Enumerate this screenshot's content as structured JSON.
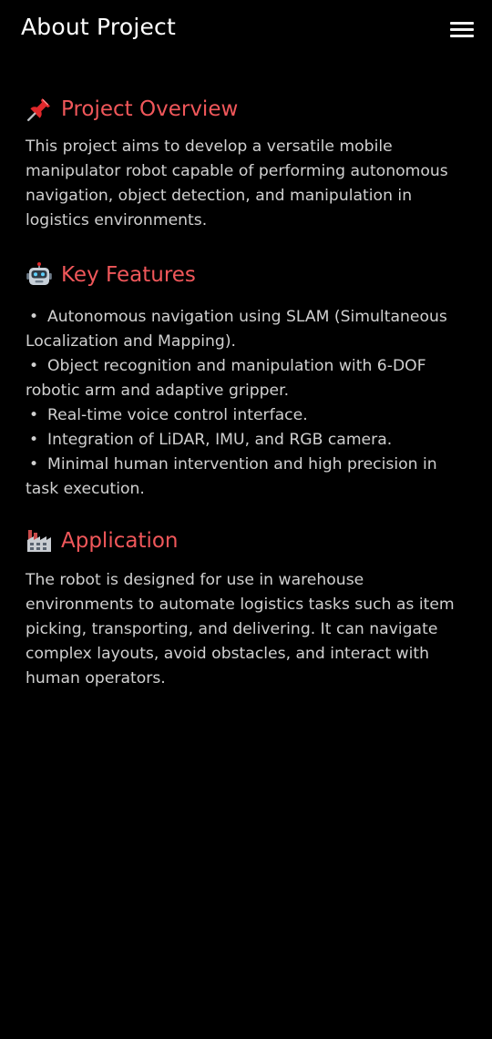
{
  "header": {
    "title": "About Project",
    "menu_icon": "hamburger-menu-icon"
  },
  "colors": {
    "background": "#000000",
    "heading": "#f0575a",
    "body_text": "#d0d0d0",
    "title_text": "#ffffff"
  },
  "sections": {
    "overview": {
      "icon": "pushpin-icon",
      "title": "Project Overview",
      "text": "This project aims to develop a versatile mobile manipulator robot capable of performing autonomous navigation, object detection, and manipulation in logistics environments."
    },
    "features": {
      "icon": "robot-face-icon",
      "title": "Key Features",
      "bullet": "•",
      "items": [
        "Autonomous navigation using SLAM (Simultaneous Localization and Mapping).",
        "Object recognition and manipulation with 6-DOF robotic arm and adaptive gripper.",
        "Real-time voice control interface.",
        "Integration of LiDAR, IMU, and RGB camera.",
        "Minimal human intervention and high precision in task execution."
      ]
    },
    "application": {
      "icon": "factory-icon",
      "title": "Application",
      "text": "The robot is designed for use in warehouse environments to automate logistics tasks such as item picking, transporting, and delivering. It can navigate complex layouts, avoid obstacles, and interact with human operators."
    }
  }
}
